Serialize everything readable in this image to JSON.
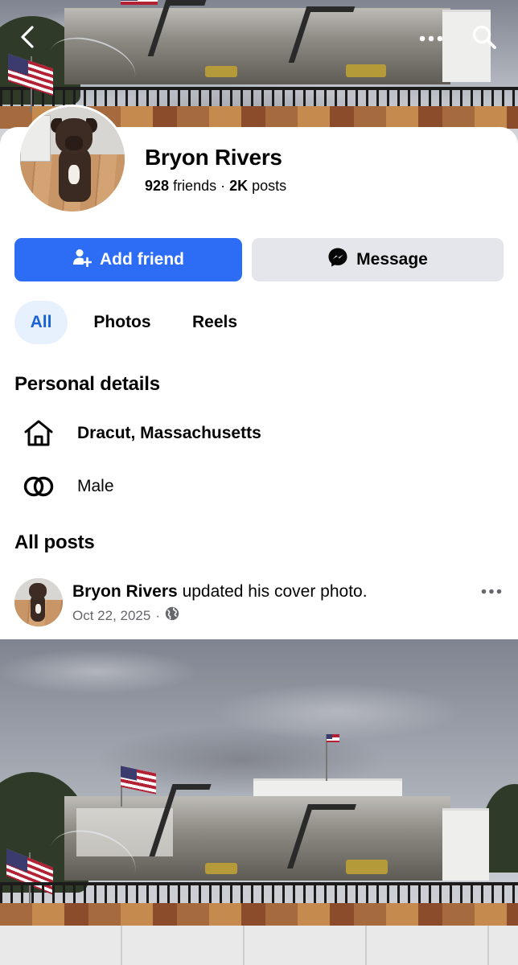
{
  "profile": {
    "name": "Bryon Rivers",
    "friends_count": "928",
    "friends_label": "friends",
    "separator": "·",
    "posts_count": "2K",
    "posts_label": "posts"
  },
  "actions": {
    "add_friend": "Add friend",
    "message": "Message"
  },
  "tabs": [
    {
      "label": "All",
      "selected": true
    },
    {
      "label": "Photos",
      "selected": false
    },
    {
      "label": "Reels",
      "selected": false
    }
  ],
  "personal_details": {
    "title": "Personal details",
    "location": "Dracut, Massachusetts",
    "gender": "Male"
  },
  "posts": {
    "title": "All posts",
    "items": [
      {
        "author": "Bryon Rivers",
        "action": "updated his cover photo.",
        "date": "Oct 22, 2025",
        "meta_separator": "·",
        "privacy": "public"
      }
    ]
  },
  "icons": {
    "back": "chevron-left-icon",
    "more": "more-horizontal-icon",
    "search": "search-icon",
    "add_friend": "add-person-icon",
    "message": "messenger-icon",
    "location": "home-icon",
    "gender": "gender-rings-icon",
    "privacy": "globe-icon",
    "post_options": "more-horizontal-icon"
  },
  "colors": {
    "primary": "#2d6df6",
    "tab_selected_bg": "#e7f1fd",
    "tab_selected_text": "#1a62d6",
    "secondary_button": "#e4e6eb",
    "muted_text": "#65676b"
  }
}
